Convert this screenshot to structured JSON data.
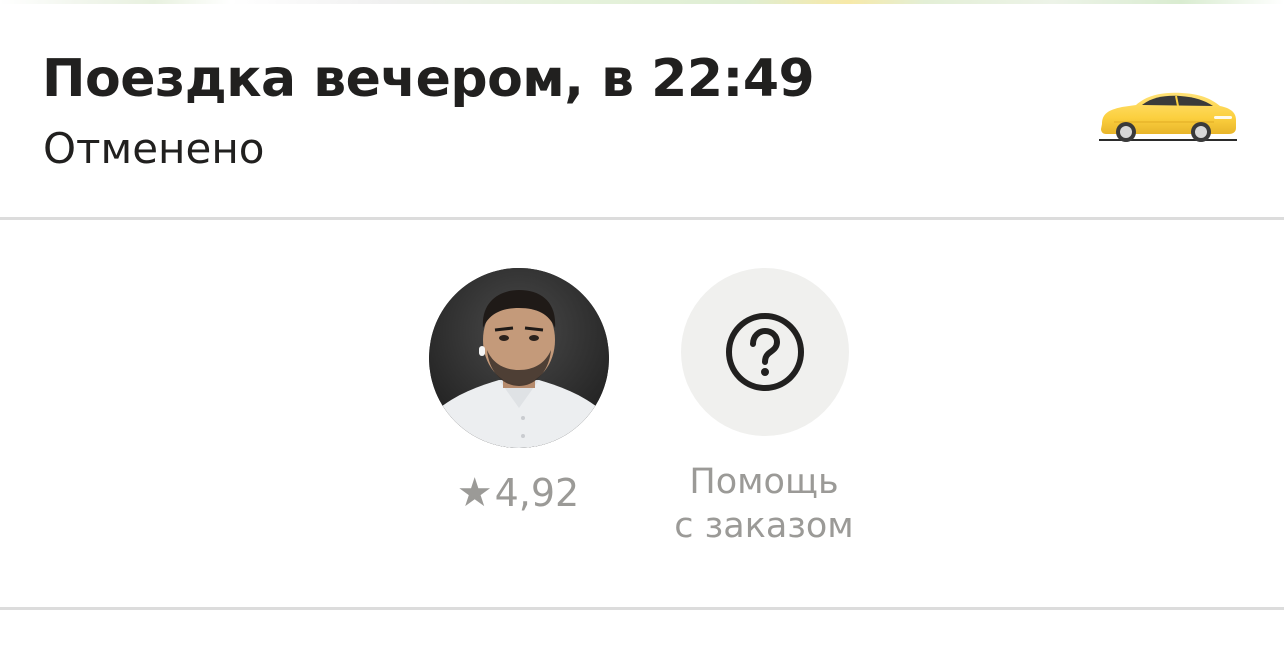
{
  "trip": {
    "title": "Поездка вечером, в 22:49",
    "status": "Отменено",
    "vehicle_icon": "taxi-car-icon"
  },
  "driver": {
    "rating_star": "★",
    "rating": "4,92",
    "avatar_icon": "driver-photo"
  },
  "help": {
    "icon": "question-circle-icon",
    "label_line1": "Помощь",
    "label_line2": "с заказом"
  },
  "colors": {
    "text_primary": "#21201f",
    "text_secondary": "#9b9a97",
    "taxi_yellow": "#fcd34a",
    "help_bg": "#f0f0ee",
    "divider": "#dcdcdc"
  }
}
